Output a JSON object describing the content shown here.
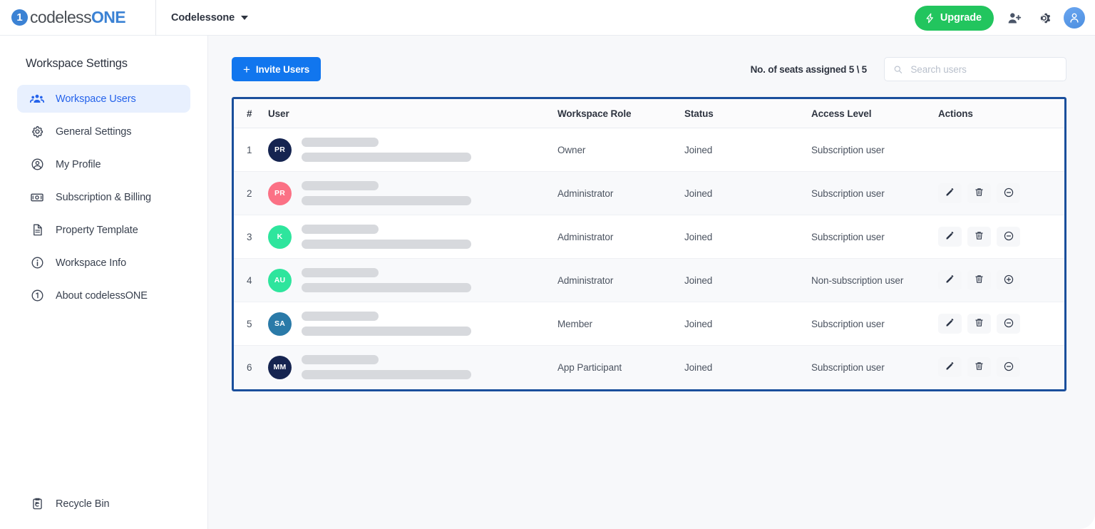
{
  "header": {
    "logo": {
      "icon": "codeless-one-logo-icon",
      "text_primary": "codeless",
      "text_secondary": "ONE",
      "mark_digit": "1"
    },
    "workspace_selector": {
      "label": "Codelessone",
      "caret_icon": "chevron-down-icon"
    },
    "upgrade_button": {
      "label": "Upgrade",
      "icon": "lightning-bolt-icon",
      "color": "#22c55e"
    },
    "add_user_icon": "add-user-icon",
    "settings_icon": "gear-icon",
    "account_avatar_icon": "user-avatar-icon"
  },
  "sidebar": {
    "title": "Workspace Settings",
    "items": [
      {
        "label": "Workspace Users",
        "icon": "users-group-icon",
        "active": true
      },
      {
        "label": "General Settings",
        "icon": "gear-icon",
        "active": false
      },
      {
        "label": "My Profile",
        "icon": "user-circle-icon",
        "active": false
      },
      {
        "label": "Subscription & Billing",
        "icon": "banknote-icon",
        "active": false
      },
      {
        "label": "Property Template",
        "icon": "document-icon",
        "active": false
      },
      {
        "label": "Workspace Info",
        "icon": "info-circle-icon",
        "active": false
      },
      {
        "label": "About codelessONE",
        "icon": "codeless-one-badge-icon",
        "active": false
      }
    ],
    "footer_item": {
      "label": "Recycle Bin",
      "icon": "recycle-bin-icon"
    }
  },
  "toolbar": {
    "invite_button": {
      "label": "Invite Users",
      "icon": "plus-icon",
      "color": "#1176ee"
    },
    "seats_label": "No. of seats assigned 5 \\ 5",
    "search": {
      "placeholder": "Search users",
      "value": "",
      "icon": "search-icon"
    }
  },
  "table": {
    "border_color": "#1a4f9c",
    "columns": [
      "#",
      "User",
      "Workspace Role",
      "Status",
      "Access Level",
      "Actions"
    ],
    "rows": [
      {
        "num": "1",
        "initials": "PR",
        "avatar_color": "#152450",
        "name_redacted": true,
        "email_redacted": true,
        "role": "Owner",
        "status": "Joined",
        "access_level": "Subscription user",
        "actions": []
      },
      {
        "num": "2",
        "initials": "PR",
        "avatar_color": "#fb7185",
        "name_redacted": true,
        "email_redacted": true,
        "role": "Administrator",
        "status": "Joined",
        "access_level": "Subscription user",
        "actions": [
          "edit-icon",
          "delete-icon",
          "minus-circle-icon"
        ]
      },
      {
        "num": "3",
        "initials": "K",
        "avatar_color": "#2ee59d",
        "name_redacted": true,
        "email_redacted": true,
        "role": "Administrator",
        "status": "Joined",
        "access_level": "Subscription user",
        "actions": [
          "edit-icon",
          "delete-icon",
          "minus-circle-icon"
        ]
      },
      {
        "num": "4",
        "initials": "AU",
        "avatar_color": "#2ee59d",
        "name_redacted": true,
        "email_redacted": true,
        "role": "Administrator",
        "status": "Joined",
        "access_level": "Non-subscription user",
        "actions": [
          "edit-icon",
          "delete-icon",
          "plus-circle-icon"
        ]
      },
      {
        "num": "5",
        "initials": "SA",
        "avatar_color": "#2a7aa8",
        "name_redacted": true,
        "email_redacted": true,
        "role": "Member",
        "status": "Joined",
        "access_level": "Subscription user",
        "actions": [
          "edit-icon",
          "delete-icon",
          "minus-circle-icon"
        ]
      },
      {
        "num": "6",
        "initials": "MM",
        "avatar_color": "#152450",
        "name_redacted": true,
        "email_redacted": true,
        "role": "App Participant",
        "status": "Joined",
        "access_level": "Subscription user",
        "actions": [
          "edit-icon",
          "delete-icon",
          "minus-circle-icon"
        ]
      }
    ]
  }
}
